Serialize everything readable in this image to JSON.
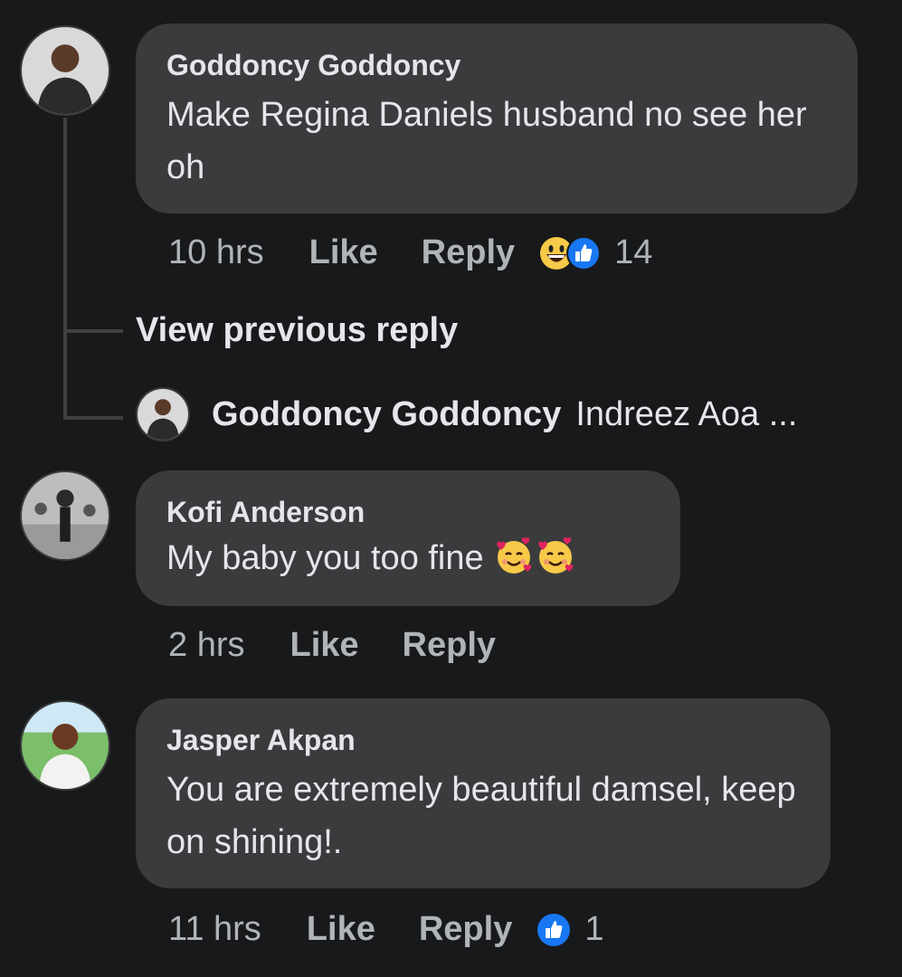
{
  "comments": [
    {
      "author": "Goddoncy Goddoncy",
      "text": "Make Regina Daniels husband no see her oh",
      "time": "10 hrs",
      "like_label": "Like",
      "reply_label": "Reply",
      "reactions": [
        "grin-emoji-icon",
        "like-reaction-icon"
      ],
      "reaction_count": "14"
    },
    {
      "author": "Kofi Anderson",
      "text": "My baby you too fine",
      "emojis": [
        "smiling-face-with-hearts-icon",
        "smiling-face-with-hearts-icon"
      ],
      "time": "2 hrs",
      "like_label": "Like",
      "reply_label": "Reply"
    },
    {
      "author": "Jasper Akpan",
      "text": "You are extremely beautiful damsel, keep on shining!.",
      "time": "11 hrs",
      "like_label": "Like",
      "reply_label": "Reply",
      "reactions": [
        "like-reaction-icon"
      ],
      "reaction_count": "1"
    }
  ],
  "thread": {
    "view_previous_label": "View previous reply",
    "reply_author": "Goddoncy Goddoncy",
    "reply_preview": "Indreez Aoa ..."
  },
  "colors": {
    "background": "#18191a",
    "bubble": "#3a3b3c",
    "text": "#e4e6eb",
    "secondary_text": "#b0b3b8",
    "like_blue": "#1877f2",
    "emoji_yellow": "#f7c948"
  }
}
